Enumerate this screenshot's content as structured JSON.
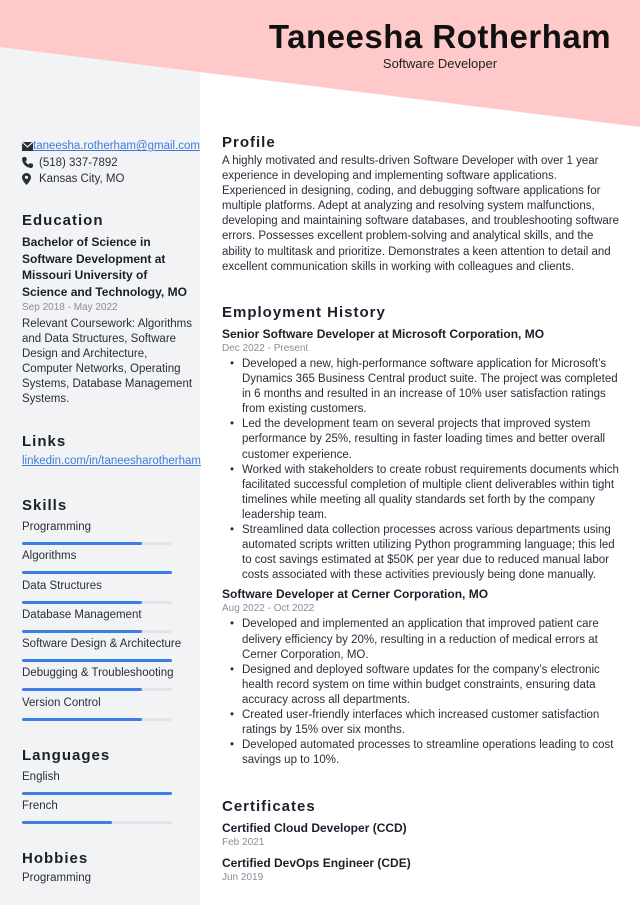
{
  "header": {
    "name": "Taneesha Rotherham",
    "role": "Software Developer",
    "banner_color": "#ffc9c9"
  },
  "contact": {
    "email": "taneesha.rotherham@gmail.com",
    "phone": "(518) 337-7892",
    "location": "Kansas City, MO",
    "icons": [
      "envelope-icon",
      "phone-icon",
      "map-pin-icon"
    ]
  },
  "education": {
    "heading": "Education",
    "degree": "Bachelor of Science in Software Development at Missouri University of Science and Technology, MO",
    "dates": "Sep 2018 - May 2022",
    "description": "Relevant Coursework: Algorithms and Data Structures, Software Design and Architecture, Computer Networks, Operating Systems, Database Management Systems."
  },
  "links": {
    "heading": "Links",
    "items": [
      {
        "label": "linkedin.com/in/taneesharotherham"
      }
    ]
  },
  "skills": {
    "heading": "Skills",
    "accent": "#3d7ee6",
    "items": [
      {
        "label": "Programming",
        "level": 0.8
      },
      {
        "label": "Algorithms",
        "level": 1.0
      },
      {
        "label": "Data Structures",
        "level": 0.8
      },
      {
        "label": "Database Management",
        "level": 0.8
      },
      {
        "label": "Software Design & Architecture",
        "level": 1.0
      },
      {
        "label": "Debugging & Troubleshooting",
        "level": 0.8
      },
      {
        "label": "Version Control",
        "level": 0.8
      }
    ]
  },
  "languages": {
    "heading": "Languages",
    "items": [
      {
        "label": "English",
        "level": 1.0
      },
      {
        "label": "French",
        "level": 0.6
      }
    ]
  },
  "hobbies": {
    "heading": "Hobbies",
    "items": [
      "Programming"
    ]
  },
  "profile": {
    "heading": "Profile",
    "text": "A highly motivated and results-driven Software Developer with over 1 year experience in developing and implementing software applications. Experienced in designing, coding, and debugging software applications for multiple platforms. Adept at analyzing and resolving system malfunctions, developing and maintaining software databases, and troubleshooting software errors. Possesses excellent problem-solving and analytical skills, and the ability to multitask and prioritize. Demonstrates a keen attention to detail and excellent communication skills in working with colleagues and clients."
  },
  "employment": {
    "heading": "Employment History",
    "jobs": [
      {
        "title": "Senior Software Developer at Microsoft Corporation, MO",
        "dates": "Dec 2022 - Present",
        "bullets": [
          "Developed a new, high-performance software application for Microsoft’s Dynamics 365 Business Central product suite. The project was completed in 6 months and resulted in an increase of 10% user satisfaction ratings from existing customers.",
          "Led the development team on several projects that improved system performance by 25%, resulting in faster loading times and better overall customer experience.",
          "Worked with stakeholders to create robust requirements documents which facilitated successful completion of multiple client deliverables within tight timelines while meeting all quality standards set forth by the company leadership team.",
          "Streamlined data collection processes across various departments using automated scripts written utilizing Python programming language; this led to cost savings estimated at $50K per year due to reduced manual labor costs associated with these activities previously being done manually."
        ]
      },
      {
        "title": "Software Developer at Cerner Corporation, MO",
        "dates": "Aug 2022 - Oct 2022",
        "bullets": [
          "Developed and implemented an application that improved patient care delivery efficiency by 20%, resulting in a reduction of medical errors at Cerner Corporation, MO.",
          "Designed and deployed software updates for the company’s electronic health record system on time within budget constraints, ensuring data accuracy across all departments.",
          "Created user-friendly interfaces which increased customer satisfaction ratings by 15% over six months.",
          "Developed automated processes to streamline operations leading to cost savings up to 10%."
        ]
      }
    ]
  },
  "certificates": {
    "heading": "Certificates",
    "items": [
      {
        "title": "Certified Cloud Developer (CCD)",
        "date": "Feb 2021"
      },
      {
        "title": "Certified DevOps Engineer (CDE)",
        "date": "Jun 2019"
      }
    ]
  }
}
